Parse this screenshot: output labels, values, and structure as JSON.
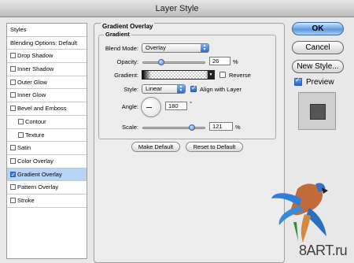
{
  "window": {
    "title": "Layer Style"
  },
  "sidebar": {
    "items": [
      {
        "label": "Styles",
        "checkbox": false,
        "checked": false
      },
      {
        "label": "Blending Options: Default",
        "checkbox": false,
        "checked": false
      },
      {
        "label": "Drop Shadow",
        "checkbox": true,
        "checked": false
      },
      {
        "label": "Inner Shadow",
        "checkbox": true,
        "checked": false
      },
      {
        "label": "Outer Glow",
        "checkbox": true,
        "checked": false
      },
      {
        "label": "Inner Glow",
        "checkbox": true,
        "checked": false
      },
      {
        "label": "Bevel and Emboss",
        "checkbox": true,
        "checked": false
      },
      {
        "label": "Contour",
        "checkbox": true,
        "checked": false
      },
      {
        "label": "Texture",
        "checkbox": true,
        "checked": false
      },
      {
        "label": "Satin",
        "checkbox": true,
        "checked": false
      },
      {
        "label": "Color Overlay",
        "checkbox": true,
        "checked": false
      },
      {
        "label": "Gradient Overlay",
        "checkbox": true,
        "checked": true
      },
      {
        "label": "Pattern Overlay",
        "checkbox": true,
        "checked": false
      },
      {
        "label": "Stroke",
        "checkbox": true,
        "checked": false
      }
    ]
  },
  "panel": {
    "title": "Gradient Overlay",
    "group_title": "Gradient",
    "blend_mode_label": "Blend Mode:",
    "blend_mode_value": "Overlay",
    "opacity_label": "Opacity:",
    "opacity_value": "26",
    "opacity_unit": "%",
    "opacity_fraction": 0.26,
    "gradient_label": "Gradient:",
    "reverse_label": "Reverse",
    "reverse_checked": false,
    "style_label": "Style:",
    "style_value": "Linear",
    "align_label": "Align with Layer",
    "align_checked": true,
    "angle_label": "Angle:",
    "angle_value": "180",
    "angle_unit": "°",
    "scale_label": "Scale:",
    "scale_value": "121",
    "scale_unit": "%",
    "scale_fraction": 0.81,
    "make_default": "Make Default",
    "reset_default": "Reset to Default"
  },
  "buttons": {
    "ok": "OK",
    "cancel": "Cancel",
    "new_style": "New Style...",
    "preview_label": "Preview",
    "preview_checked": true
  },
  "watermark": {
    "text": "8ART.ru"
  },
  "colors": {
    "selection": "#b7d4f6",
    "accent": "#2c6bd1"
  }
}
